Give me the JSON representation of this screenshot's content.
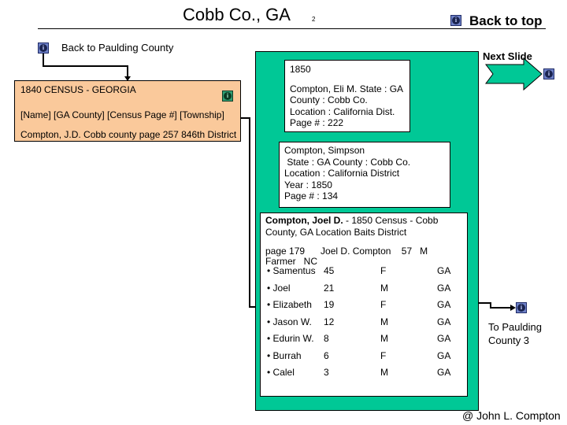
{
  "header": {
    "title": "Cobb Co., GA",
    "slide_number": "2",
    "back_to_top_label": "Back to top"
  },
  "nav": {
    "back_to_paulding_label": "Back to Paulding County",
    "next_slide_label": "Next Slide",
    "to_paulding_3_line1": "To Paulding",
    "to_paulding_3_line2": "County 3",
    "info_icon_glyph": "i"
  },
  "census_1840": {
    "title": "1840 CENSUS - GEORGIA",
    "fields": "[Name] [GA County] [Census Page #] [Township]",
    "entry": "Compton, J.D. Cobb county page 257 846th District"
  },
  "census_1850_eli": {
    "year": "1850",
    "lines": [
      "Compton, Eli M. State : GA",
      "County : Cobb Co.",
      "Location : California Dist.",
      "Page # : 222"
    ]
  },
  "census_1850_simpson": {
    "lines": [
      "Compton, Simpson",
      " State : GA County : Cobb Co.",
      "Location : California District",
      "Year : 1850",
      "Page # : 134"
    ]
  },
  "census_1850_joel": {
    "name": "Compton, Joel D.",
    "header_rest": " - 1850 Census - Cobb County, GA Location Baits District",
    "head_line1": "page 179      Joel D. Compton    57   M",
    "head_line2": "Farmer   NC",
    "household": [
      {
        "name": "• Samentus",
        "age": "45",
        "sex": "F",
        "birthplace": "GA"
      },
      {
        "name": "• Joel",
        "age": "21",
        "sex": "M",
        "birthplace": "GA"
      },
      {
        "name": "• Elizabeth",
        "age": "19",
        "sex": "F",
        "birthplace": "GA"
      },
      {
        "name": "• Jason W.",
        "age": "12",
        "sex": "M",
        "birthplace": "GA"
      },
      {
        "name": "• Edurin W.",
        "age": "8",
        "sex": "M",
        "birthplace": "GA"
      },
      {
        "name": "• Burrah",
        "age": "6",
        "sex": "F",
        "birthplace": "GA"
      },
      {
        "name": "• Calel",
        "age": "3",
        "sex": "M",
        "birthplace": "GA"
      }
    ]
  },
  "footer": {
    "copyright": "@ John L. Compton"
  },
  "colors": {
    "panel_green": "#00c896",
    "census_1840_bg": "#fac99b",
    "info_button_blue": "#6f82c9",
    "info_button_green": "#2f9e72"
  }
}
